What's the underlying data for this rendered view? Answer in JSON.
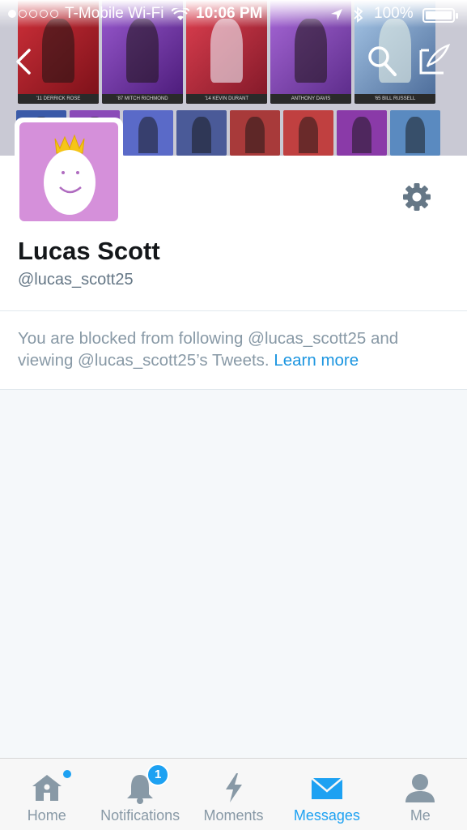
{
  "status_bar": {
    "carrier": "T-Mobile Wi-Fi",
    "time": "10:06 PM",
    "battery": "100%",
    "signal_bars_filled": 1,
    "signal_bars_total": 5
  },
  "banner": {
    "cards": [
      {
        "caption": "'11 DERRICK ROSE",
        "color": "#b8222c"
      },
      {
        "caption": "'87 MITCH RICHMOND",
        "color": "#7a3aa8"
      },
      {
        "caption": "'14 KEVIN DURANT",
        "color": "#c03040"
      },
      {
        "caption": "ANTHONY DAVIS",
        "color": "#8a4ab8"
      },
      {
        "caption": "'65 BILL RUSSELL",
        "color": "#6a8ab8"
      }
    ],
    "minis": [
      "#3a5aa8",
      "#8a4ab8",
      "#5a6ac8",
      "#4a5a98",
      "#a83a3a",
      "#c04040",
      "#8a3aa8",
      "#5a8ac0"
    ]
  },
  "profile": {
    "name": "Lucas Scott",
    "handle": "@lucas_scott25",
    "avatar_color": "#d590da"
  },
  "blocked_notice": {
    "text": "You are blocked from following @lucas_scott25 and viewing @lucas_scott25’s Tweets.",
    "link": "Learn more"
  },
  "tabs": [
    {
      "label": "Home",
      "icon": "home-icon",
      "active": false
    },
    {
      "label": "Notifications",
      "icon": "bell-icon",
      "active": false,
      "badge": "1"
    },
    {
      "label": "Moments",
      "icon": "lightning-icon",
      "active": false
    },
    {
      "label": "Messages",
      "icon": "envelope-icon",
      "active": true
    },
    {
      "label": "Me",
      "icon": "person-icon",
      "active": false
    }
  ],
  "colors": {
    "accent": "#1da1f2",
    "tab_inactive": "#8899a6"
  }
}
